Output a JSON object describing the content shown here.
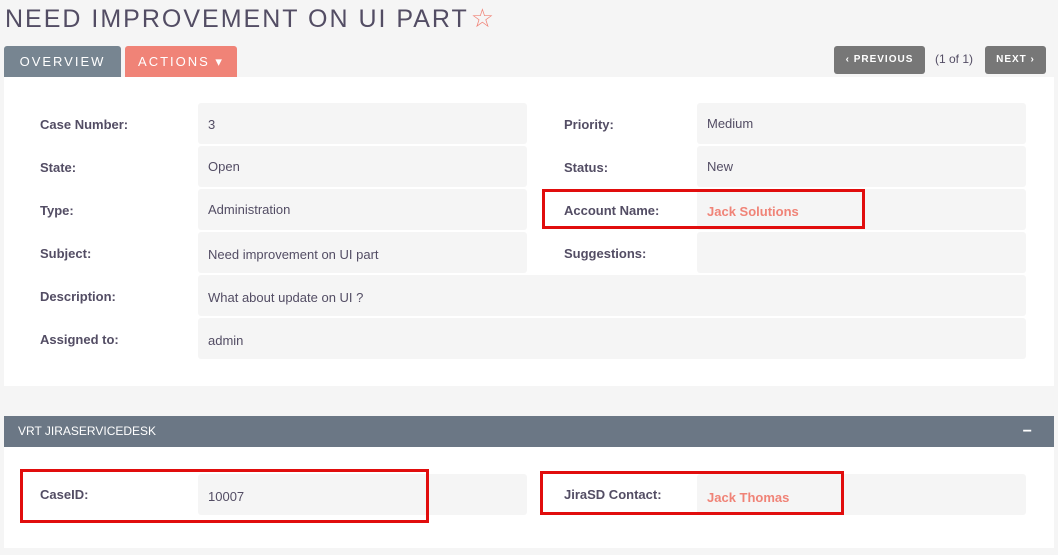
{
  "title": "NEED IMPROVEMENT ON UI PART",
  "tabs": {
    "overview": "OVERVIEW",
    "actions": "ACTIONS ▾"
  },
  "pagination": {
    "previous": "‹ PREVIOUS",
    "count": "(1 of 1)",
    "next": "NEXT ›"
  },
  "fields": {
    "case_number": {
      "label": "Case Number:",
      "value": "3"
    },
    "priority": {
      "label": "Priority:",
      "value": "Medium"
    },
    "state": {
      "label": "State:",
      "value": "Open"
    },
    "status": {
      "label": "Status:",
      "value": "New"
    },
    "type": {
      "label": "Type:",
      "value": "Administration"
    },
    "account_name": {
      "label": "Account Name:",
      "value": "Jack Solutions"
    },
    "subject": {
      "label": "Subject:",
      "value": "Need improvement on UI part"
    },
    "suggestions": {
      "label": "Suggestions:",
      "value": ""
    },
    "description": {
      "label": "Description:",
      "value": "What about update on UI ?"
    },
    "assigned_to": {
      "label": "Assigned to:",
      "value": "admin"
    }
  },
  "jira_section": {
    "title": "VRT JIRASERVICEDESK",
    "collapse": "−",
    "case_id": {
      "label": "CaseID:",
      "value": "10007"
    },
    "contact": {
      "label": "JiraSD Contact:",
      "value": "Jack Thomas"
    }
  },
  "colors": {
    "accent": "#f08377",
    "highlight": "#e10d0d",
    "header": "#6b7785"
  }
}
